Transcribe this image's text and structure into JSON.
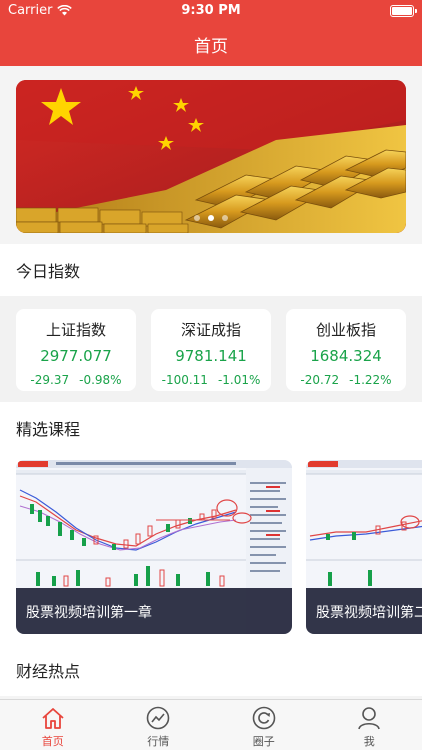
{
  "status_bar": {
    "carrier": "Carrier",
    "time": "9:30 PM"
  },
  "nav": {
    "title": "首页"
  },
  "banner": {
    "page_count": 3,
    "active_page": 2
  },
  "sections": {
    "indices_title": "今日指数",
    "courses_title": "精选课程",
    "news_title": "财经热点"
  },
  "indices": [
    {
      "name": "上证指数",
      "value": "2977.077",
      "change": "-29.37",
      "percent": "-0.98%"
    },
    {
      "name": "深证成指",
      "value": "9781.141",
      "change": "-100.11",
      "percent": "-1.01%"
    },
    {
      "name": "创业板指",
      "value": "1684.324",
      "change": "-20.72",
      "percent": "-1.22%"
    }
  ],
  "courses": [
    {
      "title": "股票视频培训第一章"
    },
    {
      "title": "股票视频培训第二章"
    }
  ],
  "tabs": [
    {
      "label": "首页",
      "icon": "home-icon",
      "active": true
    },
    {
      "label": "行情",
      "icon": "chart-icon",
      "active": false
    },
    {
      "label": "圈子",
      "icon": "circle-icon",
      "active": false
    },
    {
      "label": "我",
      "icon": "user-icon",
      "active": false
    }
  ],
  "colors": {
    "brand": "#e8453c",
    "down": "#1aa34a",
    "caption_bg": "#22243a"
  }
}
